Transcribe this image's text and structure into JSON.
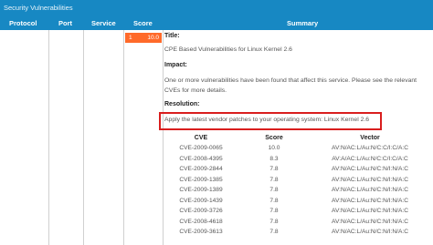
{
  "window": {
    "title": "Security Vulnerabilities"
  },
  "columns": {
    "protocol": "Protocol",
    "port": "Port",
    "service": "Service",
    "score": "Score",
    "summary": "Summary"
  },
  "row": {
    "severity": "1",
    "score": "10.0",
    "title_label": "Title:",
    "title": "CPE Based Vulnerabilities for Linux Kernel 2.6",
    "impact_label": "Impact:",
    "impact": "One or more vulnerabilities have been found that affect this service. Please see the relevant CVEs for more details.",
    "resolution_label": "Resolution:",
    "resolution": "Apply the latest vendor patches to your operating system: Linux Kernel 2.6"
  },
  "cve_table": {
    "headers": [
      "CVE",
      "Score",
      "Vector"
    ],
    "rows": [
      [
        "CVE-2009-0065",
        "10.0",
        "AV:N/AC:L/Au:N/C:C/I:C/A:C"
      ],
      [
        "CVE-2008-4395",
        "8.3",
        "AV:A/AC:L/Au:N/C:C/I:C/A:C"
      ],
      [
        "CVE-2009-2844",
        "7.8",
        "AV:N/AC:L/Au:N/C:N/I:N/A:C"
      ],
      [
        "CVE-2009-1385",
        "7.8",
        "AV:N/AC:L/Au:N/C:N/I:N/A:C"
      ],
      [
        "CVE-2009-1389",
        "7.8",
        "AV:N/AC:L/Au:N/C:N/I:N/A:C"
      ],
      [
        "CVE-2009-1439",
        "7.8",
        "AV:N/AC:L/Au:N/C:N/I:N/A:C"
      ],
      [
        "CVE-2009-3726",
        "7.8",
        "AV:N/AC:L/Au:N/C:N/I:N/A:C"
      ],
      [
        "CVE-2008-4618",
        "7.8",
        "AV:N/AC:L/Au:N/C:N/I:N/A:C"
      ],
      [
        "CVE-2009-3613",
        "7.8",
        "AV:N/AC:L/Au:N/C:N/I:N/A:C"
      ]
    ]
  },
  "colors": {
    "header": "#1788c3",
    "severity_badge": "#ff6a2a",
    "highlight_border": "#d91e1e"
  }
}
